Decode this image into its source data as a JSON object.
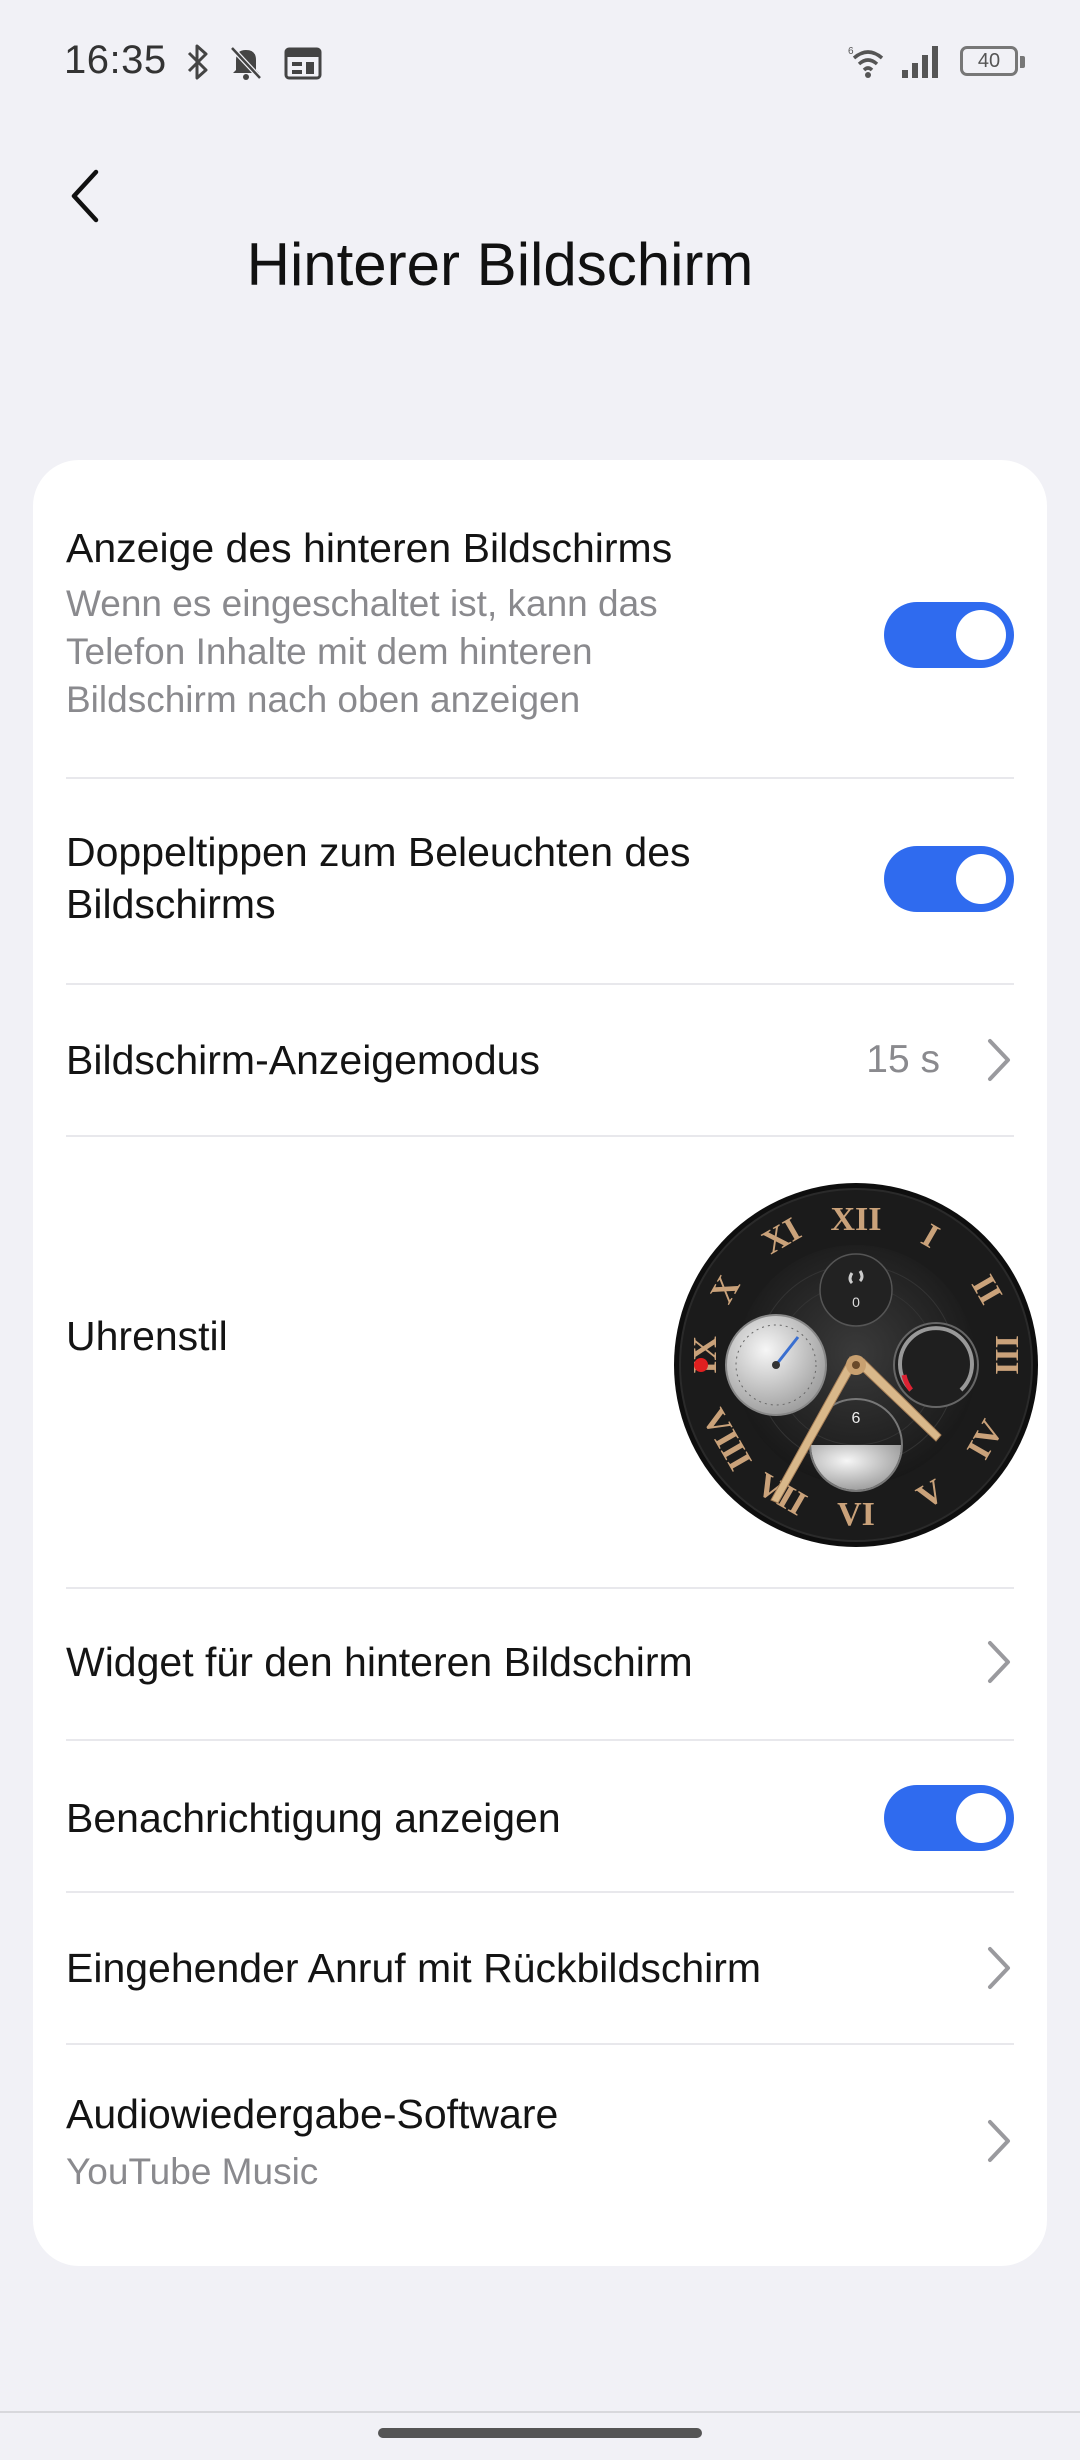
{
  "status_bar": {
    "time": "16:35",
    "battery": "40",
    "icons": [
      "bluetooth-icon",
      "mute-bell-icon",
      "calendar-icon",
      "wifi-icon",
      "signal-icon",
      "battery-icon"
    ]
  },
  "header": {
    "back_icon": "chevron-left-icon",
    "title": "Hinterer Bildschirm"
  },
  "settings": {
    "rear_display": {
      "title": "Anzeige des hinteren Bildschirms",
      "description_line1": "Wenn es eingeschaltet ist, kann das",
      "description_line2": "Telefon Inhalte mit dem hinteren",
      "description_line3": "Bildschirm nach oben anzeigen",
      "enabled": true
    },
    "double_tap": {
      "title_line1": "Doppeltippen zum Beleuchten des",
      "title_line2": "Bildschirms",
      "enabled": true
    },
    "display_mode": {
      "title": "Bildschirm-Anzeigemodus",
      "value": "15 s"
    },
    "clock_style": {
      "title": "Uhrenstil",
      "numerals": [
        "XII",
        "I",
        "II",
        "III",
        "IV",
        "V",
        "VI",
        "VII",
        "VIII",
        "IX",
        "X",
        "XI"
      ],
      "steps_value": "0",
      "date_value": "6"
    },
    "widget": {
      "title": "Widget für den hinteren Bildschirm"
    },
    "notifications": {
      "title": "Benachrichtigung anzeigen",
      "enabled": true
    },
    "incoming_call": {
      "title": "Eingehender Anruf mit Rückbildschirm"
    },
    "audio": {
      "title": "Audiowiedergabe-Software",
      "value": "YouTube Music"
    }
  },
  "colors": {
    "accent": "#2f6bef",
    "background": "#f1f1f6",
    "card": "#ffffff",
    "secondary_text": "#8a8a8e"
  }
}
